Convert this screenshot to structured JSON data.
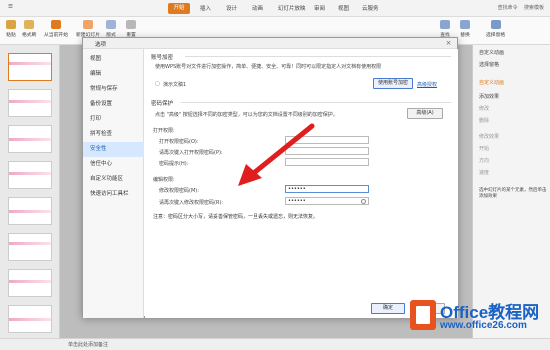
{
  "app": {
    "menu": [
      "开始",
      "插入",
      "设计",
      "动画",
      "幻灯片放映",
      "审阅",
      "视图",
      "云服务"
    ],
    "search_label": "查找命令",
    "search_template": "搜索模板",
    "colors": {
      "accent": "#e07a1e",
      "link": "#1a5fb4",
      "nav_active_bg": "#d6e8ff"
    }
  },
  "ribbon": {
    "buttons": [
      "粘贴",
      "格式刷",
      "从当前开始",
      "新建幻灯片",
      "版式",
      "重置",
      "查找",
      "替换",
      "选择窗格"
    ]
  },
  "right_pane": {
    "items": [
      "自定义动画",
      "选择窗格",
      "自定义动画",
      "添加效果",
      "修改",
      "删除",
      "修改效果",
      "开始",
      "方向",
      "速度",
      "选中幻灯片的某个元素，然后单击",
      "添加效果"
    ]
  },
  "statusbar": {
    "note": "单击此处添加备注"
  },
  "dialog": {
    "title": "选项",
    "close_icon": "close-icon",
    "nav": [
      "视图",
      "编辑",
      "常规与保存",
      "备份设置",
      "打印",
      "拼写检查",
      "安全性",
      "信任中心",
      "自定义功能区",
      "快速访问工具栏"
    ],
    "active_nav": "安全性",
    "doc_encrypt": {
      "title": "账号加密",
      "desc": "使用WPS账号对文件进行加密操作，简单、便捷、安全、可靠！同时可以限定指定人对文档有使用权限",
      "current_doc_label": "演示文稿1",
      "encrypt_button": "使用账号加密",
      "advanced_link": "高级授权"
    },
    "password_protect": {
      "title": "密码保护",
      "desc": "点击 \"高级\" 按钮选择不同的加密类型，可以为您的文档设置不同级别的加密保护。",
      "advanced_button": "高级(A)"
    },
    "open_perm": {
      "title": "打开权限:",
      "open_password_label": "打开权限密码(O):",
      "reenter_open_label": "请再次键入打开权限密码(P):",
      "hint_label": "密码提示(H):",
      "open_password_value": "",
      "reenter_open_value": "",
      "hint_value": ""
    },
    "edit_perm": {
      "title": "编辑权限:",
      "modify_password_label": "修改权限密码(M):",
      "reenter_modify_label": "请再次键入修改权限密码(R):",
      "modify_password_value": "••••••",
      "reenter_modify_value": "••••••"
    },
    "warning": "注意：密码区分大小写，请妥善保管密码，一旦丢失或遗忘，则无法恢复。",
    "ok_button": "确定",
    "cancel_button": "取消"
  },
  "watermark": {
    "line1": "Office教程网",
    "line2": "www.office26.com"
  }
}
